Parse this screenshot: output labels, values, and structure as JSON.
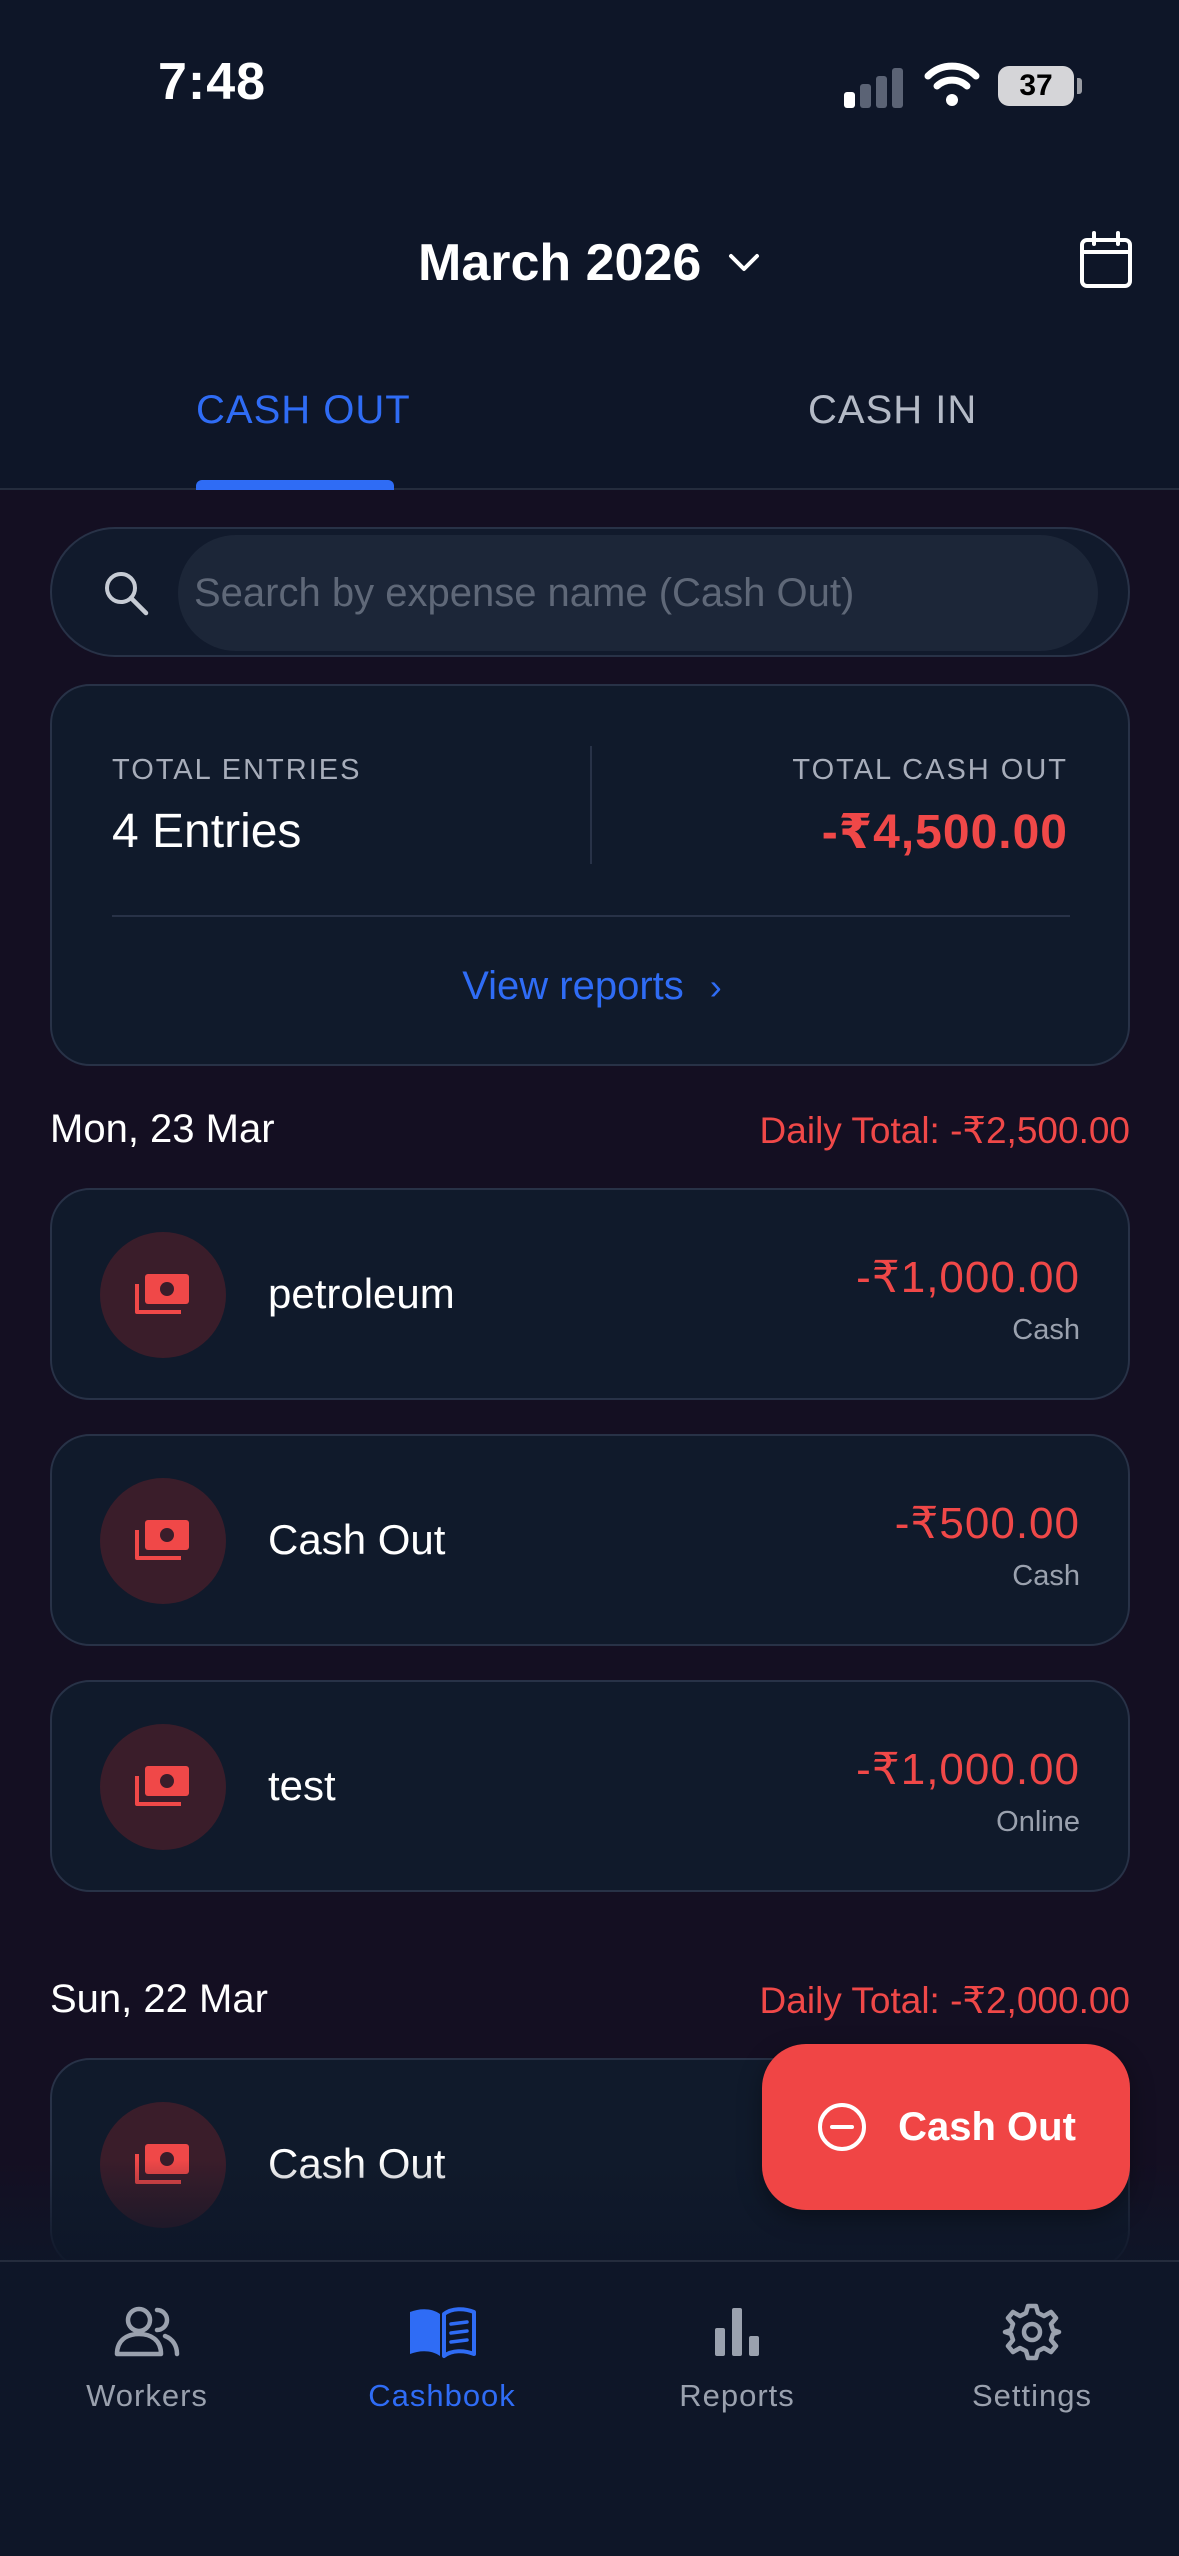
{
  "status_bar": {
    "time": "7:48",
    "battery": "37"
  },
  "header": {
    "month": "March 2026"
  },
  "tabs": [
    {
      "label": "CASH OUT",
      "active": true
    },
    {
      "label": "CASH IN",
      "active": false
    }
  ],
  "search": {
    "placeholder": "Search by expense name (Cash Out)",
    "value": ""
  },
  "summary": {
    "entries_label": "TOTAL ENTRIES",
    "entries_value": "4 Entries",
    "total_label": "TOTAL CASH OUT",
    "total_value": "-₹4,500.00",
    "view_reports": "View reports"
  },
  "days": [
    {
      "date": "Mon, 23 Mar",
      "total": "Daily Total: -₹2,500.00",
      "entries": [
        {
          "name": "petroleum",
          "amount": "-₹1,000.00",
          "method": "Cash"
        },
        {
          "name": "Cash Out",
          "amount": "-₹500.00",
          "method": "Cash"
        },
        {
          "name": "test",
          "amount": "-₹1,000.00",
          "method": "Online"
        }
      ]
    },
    {
      "date": "Sun, 22 Mar",
      "total": "Daily Total: -₹2,000.00",
      "entries": [
        {
          "name": "Cash Out",
          "amount": "",
          "method": ""
        }
      ]
    }
  ],
  "fab": {
    "label": "Cash Out"
  },
  "nav": [
    {
      "label": "Workers",
      "icon": "users-icon"
    },
    {
      "label": "Cashbook",
      "icon": "book-icon",
      "active": true
    },
    {
      "label": "Reports",
      "icon": "bar-chart-icon"
    },
    {
      "label": "Settings",
      "icon": "gear-icon"
    }
  ],
  "colors": {
    "accent": "#2f6cf5",
    "negative": "#f04848",
    "background": "#140f22",
    "surface": "#101a2b"
  }
}
